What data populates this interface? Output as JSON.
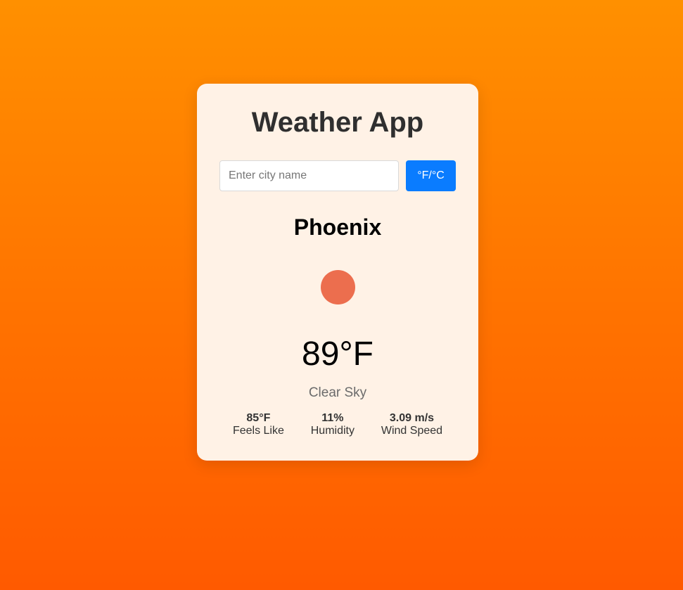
{
  "app": {
    "title": "Weather App"
  },
  "search": {
    "placeholder": "Enter city name",
    "value": "",
    "unit_toggle_label": "°F/°C"
  },
  "weather": {
    "city": "Phoenix",
    "icon": "sun-icon",
    "icon_color": "#ec6e4e",
    "temperature": "89°F",
    "description": "Clear Sky"
  },
  "details": [
    {
      "value": "85°F",
      "label": "Feels Like"
    },
    {
      "value": "11%",
      "label": "Humidity"
    },
    {
      "value": "3.09 m/s",
      "label": "Wind Speed"
    }
  ],
  "colors": {
    "accent": "#0a7cff",
    "card_background": "#fff2e6"
  }
}
